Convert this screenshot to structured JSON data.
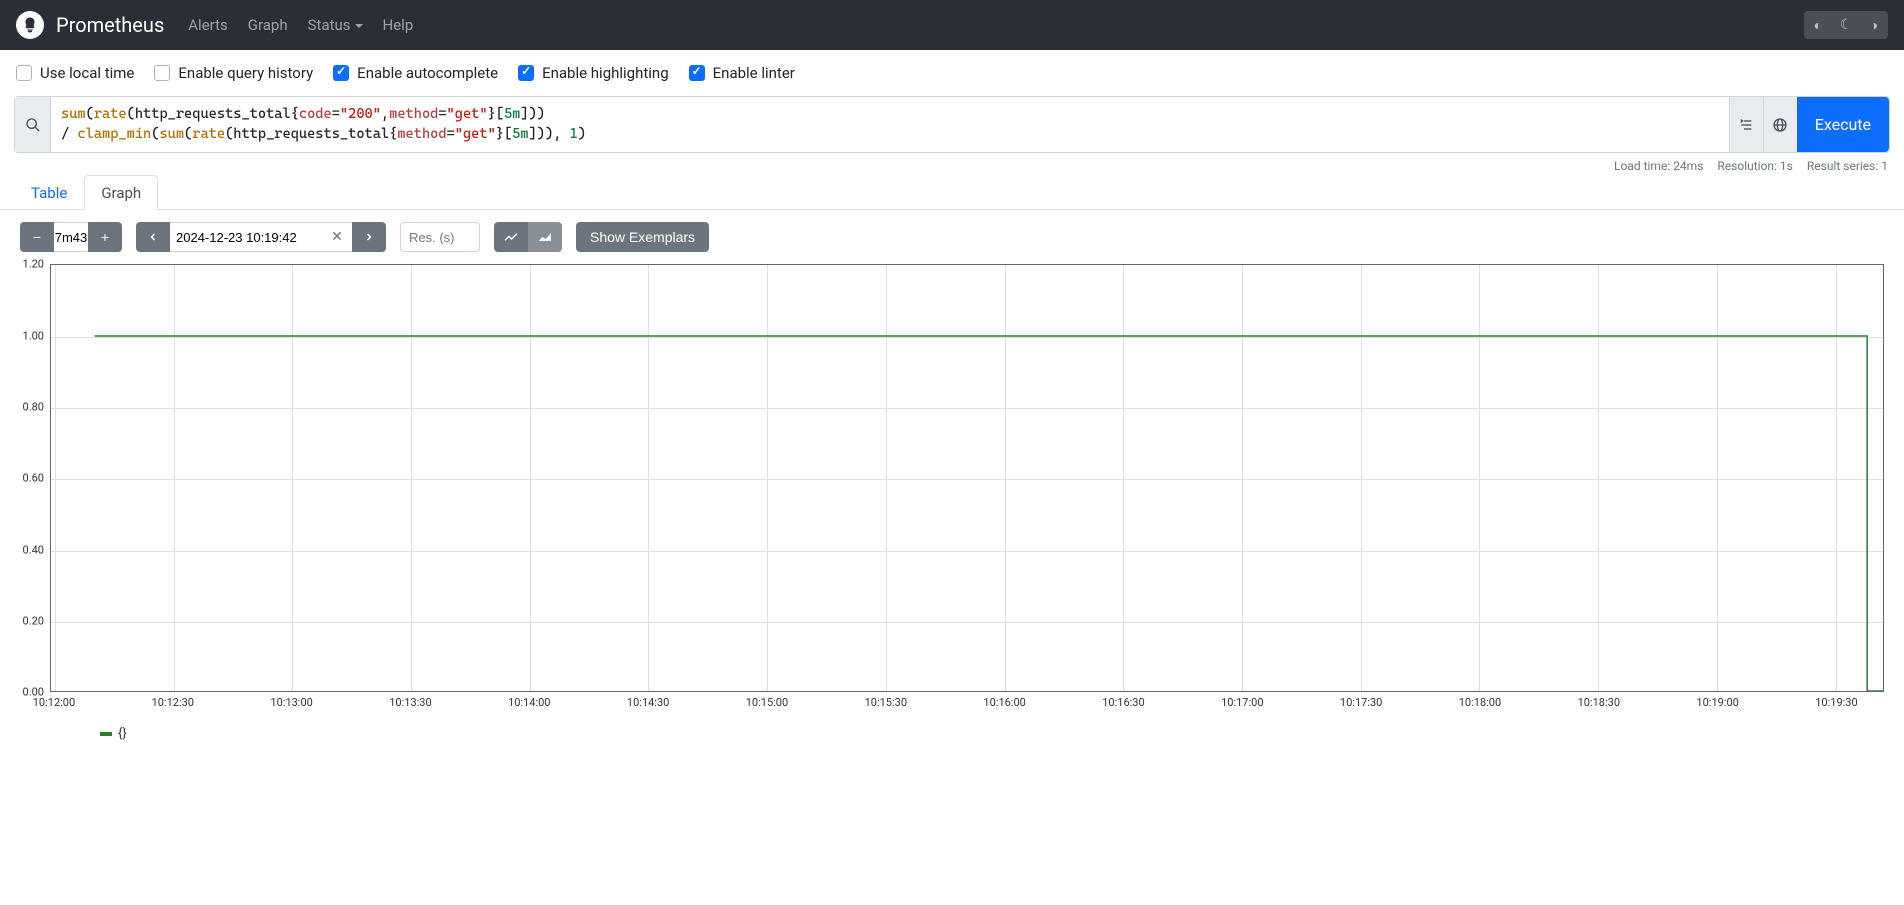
{
  "navbar": {
    "brand": "Prometheus",
    "links": [
      "Alerts",
      "Graph",
      "Status",
      "Help"
    ]
  },
  "options": {
    "use_local_time": {
      "label": "Use local time",
      "checked": false
    },
    "enable_query_history": {
      "label": "Enable query history",
      "checked": false
    },
    "enable_autocomplete": {
      "label": "Enable autocomplete",
      "checked": true
    },
    "enable_highlighting": {
      "label": "Enable highlighting",
      "checked": true
    },
    "enable_linter": {
      "label": "Enable linter",
      "checked": true
    }
  },
  "query": {
    "tokens": [
      [
        {
          "t": "func",
          "v": "sum"
        },
        {
          "t": "p",
          "v": "("
        },
        {
          "t": "func",
          "v": "rate"
        },
        {
          "t": "p",
          "v": "(http_requests_total{"
        },
        {
          "t": "label",
          "v": "code"
        },
        {
          "t": "p",
          "v": "="
        },
        {
          "t": "str",
          "v": "\"200\""
        },
        {
          "t": "p",
          "v": ","
        },
        {
          "t": "label",
          "v": "method"
        },
        {
          "t": "p",
          "v": "="
        },
        {
          "t": "str",
          "v": "\"get\""
        },
        {
          "t": "p",
          "v": "}["
        },
        {
          "t": "dur",
          "v": "5m"
        },
        {
          "t": "p",
          "v": "]))"
        }
      ],
      [
        {
          "t": "p",
          "v": "/ "
        },
        {
          "t": "func",
          "v": "clamp_min"
        },
        {
          "t": "p",
          "v": "("
        },
        {
          "t": "func",
          "v": "sum"
        },
        {
          "t": "p",
          "v": "("
        },
        {
          "t": "func",
          "v": "rate"
        },
        {
          "t": "p",
          "v": "(http_requests_total{"
        },
        {
          "t": "label",
          "v": "method"
        },
        {
          "t": "p",
          "v": "="
        },
        {
          "t": "str",
          "v": "\"get\""
        },
        {
          "t": "p",
          "v": "}["
        },
        {
          "t": "dur",
          "v": "5m"
        },
        {
          "t": "p",
          "v": "])), "
        },
        {
          "t": "num",
          "v": "1"
        },
        {
          "t": "p",
          "v": ")"
        }
      ]
    ]
  },
  "execute_label": "Execute",
  "stats": {
    "load_time": "Load time: 24ms",
    "resolution": "Resolution: 1s",
    "result_series": "Result series: 1"
  },
  "tabs": {
    "table": "Table",
    "graph": "Graph"
  },
  "controls": {
    "range": "7m43",
    "time": "2024-12-23 10:19:42",
    "res_placeholder": "Res. (s)",
    "show_exemplars": "Show Exemplars"
  },
  "legend": {
    "label": "{}"
  },
  "chart_data": {
    "type": "line",
    "title": "",
    "xlabel": "",
    "ylabel": "",
    "ylim": [
      0,
      1.2
    ],
    "y_ticks": [
      0.0,
      0.2,
      0.4,
      0.6,
      0.8,
      1.0,
      1.2
    ],
    "x_ticks": [
      "10:12:00",
      "10:12:30",
      "10:13:00",
      "10:13:30",
      "10:14:00",
      "10:14:30",
      "10:15:00",
      "10:15:30",
      "10:16:00",
      "10:16:30",
      "10:17:00",
      "10:17:30",
      "10:18:00",
      "10:18:30",
      "10:19:00",
      "10:19:30"
    ],
    "x_range": [
      "10:11:59",
      "10:19:42"
    ],
    "series": [
      {
        "name": "{}",
        "color": "#2e7d32",
        "points": [
          {
            "x": "10:12:10",
            "y": 1.0
          },
          {
            "x": "10:19:38",
            "y": 1.0
          },
          {
            "x": "10:19:38",
            "y": 0.0
          },
          {
            "x": "10:19:42",
            "y": 0.0
          }
        ]
      }
    ]
  }
}
